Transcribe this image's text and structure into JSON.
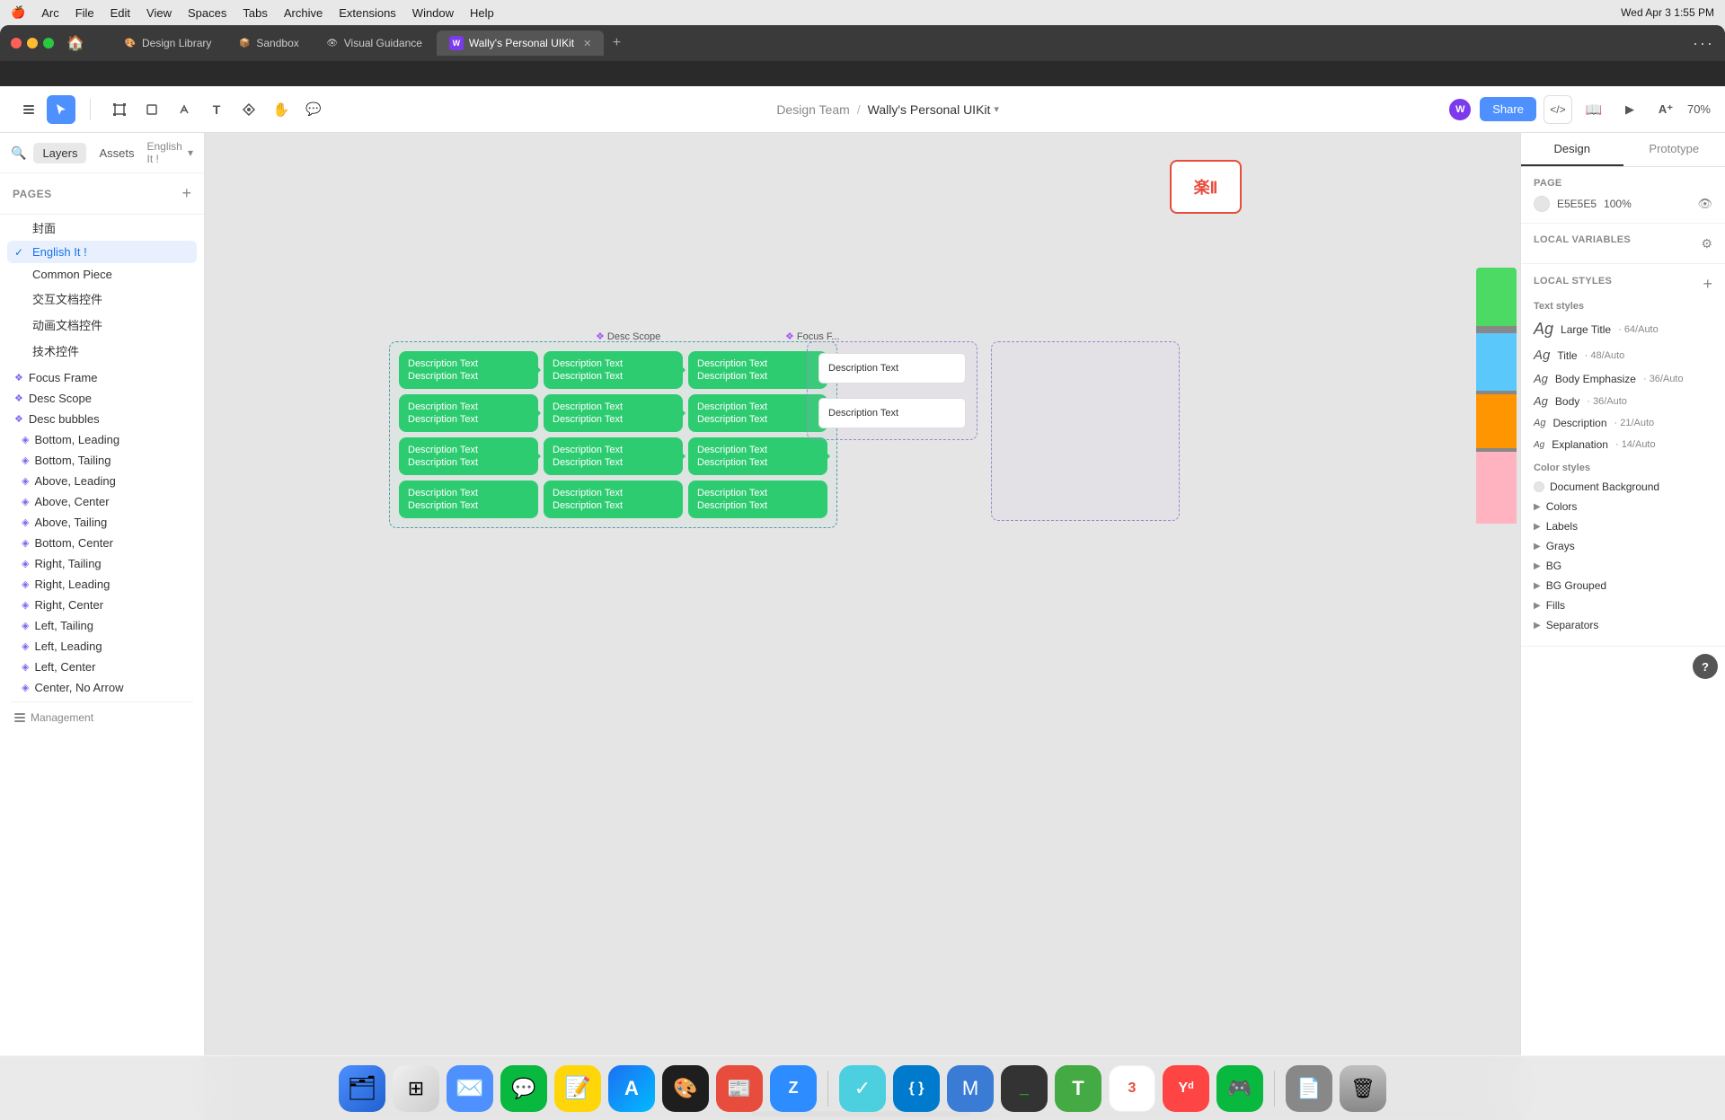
{
  "os": {
    "menubar": {
      "apple": "🍎",
      "items": [
        "Arc",
        "File",
        "Edit",
        "View",
        "Spaces",
        "Tabs",
        "Archive",
        "Extensions",
        "Window",
        "Help"
      ],
      "right_time": "Wed Apr 3  1:55 PM"
    }
  },
  "browser": {
    "tabs": [
      {
        "label": "Design Library",
        "active": false,
        "favicon": "🎨"
      },
      {
        "label": "Sandbox",
        "active": false,
        "favicon": "📦"
      },
      {
        "label": "Visual Guidance",
        "active": false,
        "favicon": "👁"
      },
      {
        "label": "Wally's Personal UIKit",
        "active": true,
        "favicon": "W",
        "closable": true
      }
    ],
    "add_tab": "+",
    "more": "···"
  },
  "toolbar": {
    "title_team": "Design Team",
    "title_sep": "/",
    "title_name": "Wally's Personal UIKit",
    "title_caret": "▾",
    "share_label": "Share",
    "code_label": "</>",
    "zoom_label": "70%"
  },
  "left_sidebar": {
    "tabs": [
      "Layers",
      "Assets"
    ],
    "search_icon": "🔍",
    "lang_label": "English It !",
    "pages_title": "Pages",
    "pages_add": "+",
    "pages": [
      {
        "label": "封面",
        "active": false
      },
      {
        "label": "English It !",
        "active": true
      },
      {
        "label": "Common Piece",
        "active": false
      },
      {
        "label": "交互文档控件",
        "active": false
      },
      {
        "label": "动画文档控件",
        "active": false
      },
      {
        "label": "技术控件",
        "active": false
      }
    ],
    "layers": [
      {
        "label": "Focus Frame",
        "icon": "comp",
        "indent": 0
      },
      {
        "label": "Desc Scope",
        "icon": "comp",
        "indent": 0
      },
      {
        "label": "Desc bubbles",
        "icon": "comp",
        "indent": 0
      },
      {
        "label": "Bottom, Leading",
        "icon": "comp",
        "indent": 1
      },
      {
        "label": "Bottom, Tailing",
        "icon": "comp",
        "indent": 1
      },
      {
        "label": "Above, Leading",
        "icon": "comp",
        "indent": 1
      },
      {
        "label": "Above, Center",
        "icon": "comp",
        "indent": 1
      },
      {
        "label": "Above, Tailing",
        "icon": "comp",
        "indent": 1
      },
      {
        "label": "Bottom, Center",
        "icon": "comp",
        "indent": 1
      },
      {
        "label": "Right, Tailing",
        "icon": "comp",
        "indent": 1
      },
      {
        "label": "Right, Leading",
        "icon": "comp",
        "indent": 1
      },
      {
        "label": "Right, Center",
        "icon": "comp",
        "indent": 1
      },
      {
        "label": "Left, Tailing",
        "icon": "comp",
        "indent": 1
      },
      {
        "label": "Left, Leading",
        "icon": "comp",
        "indent": 1
      },
      {
        "label": "Left, Center",
        "icon": "comp",
        "indent": 1
      },
      {
        "label": "Center, No Arrow",
        "icon": "comp",
        "indent": 1
      }
    ],
    "management_label": "Management"
  },
  "canvas": {
    "desc_scope_label": "Desc Scope",
    "focus_frame_label": "Focus F...",
    "green_cards": [
      {
        "line1": "Description Text",
        "line2": "Description Text"
      },
      {
        "line1": "Description Text",
        "line2": "Description Text"
      },
      {
        "line1": "Description Text",
        "line2": "Description Text"
      },
      {
        "line1": "Description Text",
        "line2": "Description Text"
      },
      {
        "line1": "Description Text",
        "line2": "Description Text"
      },
      {
        "line1": "Description Text",
        "line2": "Description Text"
      },
      {
        "line1": "Description Text",
        "line2": "Description Text"
      },
      {
        "line1": "Description Text",
        "line2": "Description Text"
      },
      {
        "line1": "Description Text",
        "line2": "Description Text"
      },
      {
        "line1": "Description Text",
        "line2": "Description Text"
      },
      {
        "line1": "Description Text",
        "line2": "Description Text"
      },
      {
        "line1": "Description Text",
        "line2": "Description Text"
      }
    ],
    "desc_texts": [
      "Description Text",
      "Description Text"
    ]
  },
  "right_panel": {
    "tabs": [
      "Design",
      "Prototype"
    ],
    "active_tab": "Design",
    "page_section": {
      "title": "Page",
      "color": "E5E5E5",
      "opacity": "100%"
    },
    "local_vars": {
      "title": "Local variables"
    },
    "local_styles": {
      "title": "Local styles",
      "text_styles_title": "Text styles",
      "text_styles": [
        {
          "ag": "Ag",
          "name": "Large Title",
          "size": "64/Auto"
        },
        {
          "ag": "Ag",
          "name": "Title",
          "size": "48/Auto"
        },
        {
          "ag": "Ag",
          "name": "Body Emphasize",
          "size": "36/Auto"
        },
        {
          "ag": "Ag",
          "name": "Body",
          "size": "36/Auto"
        },
        {
          "ag": "Ag",
          "name": "Description",
          "size": "21/Auto"
        },
        {
          "ag": "Ag",
          "name": "Explanation",
          "size": "14/Auto"
        }
      ],
      "color_styles_title": "Color styles",
      "color_groups": [
        {
          "name": "Document Background",
          "swatch": "#e5e5e5",
          "has_arrow": false
        },
        {
          "name": "Colors",
          "swatch": "#4cd964",
          "has_arrow": true
        },
        {
          "name": "Labels",
          "swatch": "#555",
          "has_arrow": true
        },
        {
          "name": "Grays",
          "swatch": "#aaa",
          "has_arrow": true
        },
        {
          "name": "BG",
          "swatch": "#fff",
          "has_arrow": true
        },
        {
          "name": "BG Grouped",
          "swatch": "#f5f5f5",
          "has_arrow": true
        },
        {
          "name": "Fills",
          "swatch": "#ddd",
          "has_arrow": true
        },
        {
          "name": "Separators",
          "swatch": "#ccc",
          "has_arrow": true
        }
      ]
    }
  },
  "dock": {
    "items": [
      {
        "name": "Finder",
        "emoji": "🗂",
        "color": "#4d90fe"
      },
      {
        "name": "Launchpad",
        "emoji": "🚀",
        "color": "#f4f4f4"
      },
      {
        "name": "Mail",
        "emoji": "✉️",
        "color": "#4d90fe"
      },
      {
        "name": "Wechat",
        "emoji": "💬",
        "color": "#09b83e"
      },
      {
        "name": "Notes",
        "emoji": "📝",
        "color": "#ffd60a"
      },
      {
        "name": "App Store",
        "emoji": "🅰",
        "color": "#1d6ff3"
      },
      {
        "name": "Figma",
        "emoji": "🎨",
        "color": "#f24e1e"
      },
      {
        "name": "Reeder",
        "emoji": "📰",
        "color": "#e74c3c"
      },
      {
        "name": "Zoom",
        "emoji": "Z",
        "color": "#2d8cff"
      },
      {
        "name": "Things",
        "emoji": "✓",
        "color": "#4cd0e0"
      },
      {
        "name": "VSCode",
        "emoji": "{ }",
        "color": "#007acc"
      },
      {
        "name": "Mimestream",
        "emoji": "M",
        "color": "#4d90fe"
      },
      {
        "name": "Terminal",
        "emoji": ">_",
        "color": "#333"
      },
      {
        "name": "Typora",
        "emoji": "T",
        "color": "#6c4"
      },
      {
        "name": "Calendar",
        "emoji": "3",
        "color": "#e74c3c"
      },
      {
        "name": "Dictionary",
        "emoji": "Yᵈ",
        "color": "#f44"
      },
      {
        "name": "Wechat2",
        "emoji": "🎮",
        "color": "#09b83e"
      },
      {
        "name": "Markdown",
        "emoji": "📄",
        "color": "#888"
      },
      {
        "name": "Trash",
        "emoji": "🗑",
        "color": "#888"
      }
    ]
  }
}
